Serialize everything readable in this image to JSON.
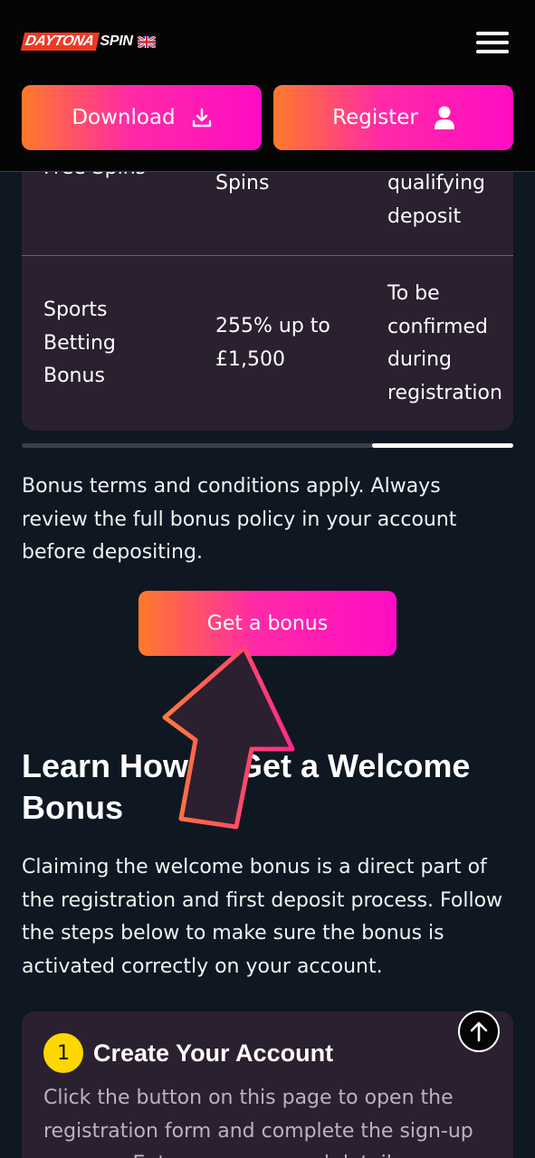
{
  "header": {
    "logo_part1": "DAYTONA",
    "logo_part2": "SPIN",
    "download_label": "Download",
    "register_label": "Register"
  },
  "bonus_table": {
    "partial_row": {
      "col1": "Free Spins",
      "col2": "Spins",
      "col3": "qualifying deposit"
    },
    "rows": [
      {
        "type": "Sports Betting Bonus",
        "amount": "255% up to £1,500",
        "code": "To be confirmed during registration"
      }
    ]
  },
  "terms_text": "Bonus terms and conditions apply. Always review the full bonus policy in your account before depositing.",
  "cta_label": "Get a bonus",
  "section": {
    "title": "Learn How to Get a Welcome Bonus",
    "intro": "Claiming the welcome bonus is a direct part of the registration and first deposit process. Follow the steps below to make sure the bonus is activated correctly on your account."
  },
  "steps": [
    {
      "number": "1",
      "title": "Create Your Account",
      "text": "Click the button on this page to open the registration form and complete the sign-up process. Enter your personal details"
    }
  ],
  "colors": {
    "page_bg": "#0e1722",
    "header_bg": "#050505",
    "card_bg": "#2a2030",
    "gradient_start": "#ff7a2a",
    "gradient_end": "#ff0cc4",
    "step_badge": "#ffd700"
  },
  "icons": {
    "download": "download-icon",
    "register": "user-icon",
    "menu": "hamburger-menu-icon",
    "scroll_top": "arrow-up-icon",
    "flag": "uk-flag-icon",
    "pointer": "pointer-arrow-icon"
  }
}
